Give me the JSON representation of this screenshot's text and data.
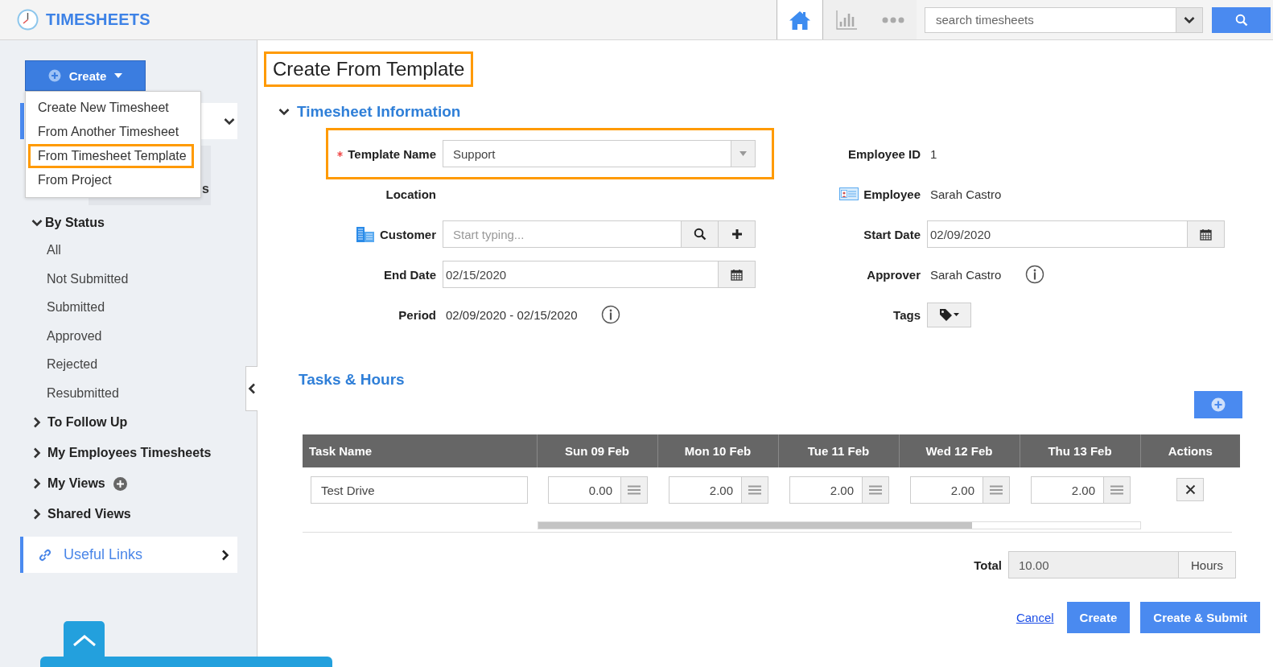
{
  "app": {
    "title": "TIMESHEETS"
  },
  "header": {
    "nav": [
      {
        "kind": "home",
        "selected": true
      },
      {
        "kind": "chart",
        "selected": false
      },
      {
        "kind": "more",
        "selected": false
      }
    ],
    "search": {
      "placeholder": "search timesheets"
    }
  },
  "sidebar": {
    "create_button": "Create",
    "create_menu": [
      {
        "label": "Create New Timesheet",
        "highlighted": false
      },
      {
        "label": "From Another Timesheet",
        "highlighted": false
      },
      {
        "label": "From Timesheet Template",
        "highlighted": true
      },
      {
        "label": "From Project",
        "highlighted": false
      }
    ],
    "covered_item_text": "s",
    "groups": [
      {
        "label": "By Status",
        "expanded": true,
        "addable": false,
        "children": [
          {
            "label": "All"
          },
          {
            "label": "Not Submitted"
          },
          {
            "label": "Submitted"
          },
          {
            "label": "Approved"
          },
          {
            "label": "Rejected"
          },
          {
            "label": "Resubmitted"
          }
        ]
      },
      {
        "label": "To Follow Up",
        "expanded": false,
        "addable": false
      },
      {
        "label": "My Employees Timesheets",
        "expanded": false,
        "addable": false
      },
      {
        "label": "My Views",
        "expanded": false,
        "addable": true
      },
      {
        "label": "Shared Views",
        "expanded": false,
        "addable": false
      }
    ],
    "useful_links": "Useful Links"
  },
  "main": {
    "title": "Create From Template",
    "title_highlighted": true,
    "info_section": {
      "title": "Timesheet Information",
      "expanded": true,
      "left_fields": [
        {
          "kind": "select",
          "label": "Template Name",
          "required": true,
          "highlighted": true,
          "value": "Support"
        },
        {
          "kind": "empty",
          "label": "Location",
          "required": false,
          "highlighted": false
        },
        {
          "kind": "lookup",
          "label": "Customer",
          "required": false,
          "highlighted": false,
          "placeholder": "Start typing..."
        },
        {
          "kind": "date",
          "label": "End Date",
          "required": false,
          "highlighted": false,
          "value": "02/15/2020"
        },
        {
          "kind": "text",
          "label": "Period",
          "required": false,
          "highlighted": false,
          "value": "02/09/2020 - 02/15/2020",
          "info": true
        }
      ],
      "right_fields": [
        {
          "kind": "text",
          "label": "Employee ID",
          "required": false,
          "highlighted": false,
          "value": "1",
          "info": false
        },
        {
          "kind": "person",
          "label": "Employee",
          "required": false,
          "highlighted": false,
          "value": "Sarah Castro"
        },
        {
          "kind": "date",
          "label": "Start Date",
          "required": false,
          "highlighted": false,
          "value": "02/09/2020"
        },
        {
          "kind": "text",
          "label": "Approver",
          "required": false,
          "highlighted": false,
          "value": "Sarah Castro",
          "info": true
        },
        {
          "kind": "tags",
          "label": "Tags",
          "required": false,
          "highlighted": false
        }
      ]
    },
    "tasks": {
      "title": "Tasks & Hours",
      "columns": [
        "Task Name",
        "Sun 09 Feb",
        "Mon 10 Feb",
        "Tue 11 Feb",
        "Wed 12 Feb",
        "Thu 13 Feb",
        "Actions"
      ],
      "rows": [
        {
          "task": "Test Drive",
          "hours": [
            "0.00",
            "2.00",
            "2.00",
            "2.00",
            "2.00"
          ]
        }
      ],
      "total_label": "Total",
      "total": "10.00",
      "total_unit": "Hours"
    },
    "actions": {
      "cancel": "Cancel",
      "create": "Create",
      "create_submit": "Create & Submit"
    }
  }
}
